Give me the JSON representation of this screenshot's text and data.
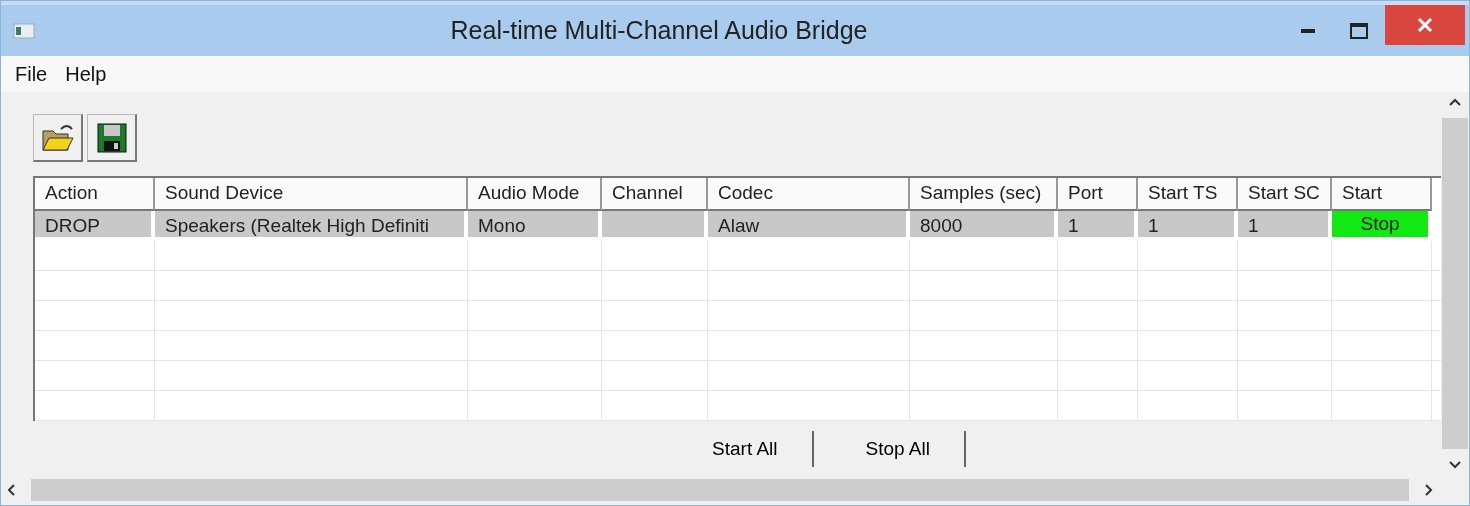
{
  "window": {
    "title": "Real-time Multi-Channel Audio Bridge"
  },
  "menu": [
    "File",
    "Help"
  ],
  "table": {
    "columns": [
      "Action",
      "Sound Device",
      "Audio Mode",
      "Channel",
      "Codec",
      "Samples (sec)",
      "Port",
      "Start TS",
      "Start SC",
      "Start"
    ],
    "rows": [
      {
        "selected": true,
        "cells": [
          "DROP",
          "Speakers (Realtek High Definiti",
          "Mono",
          "",
          "Alaw",
          "8000",
          "1",
          "1",
          "1"
        ],
        "start": {
          "label": "Stop",
          "active": true
        }
      }
    ]
  },
  "buttons": [
    "Start All",
    "Stop All"
  ]
}
